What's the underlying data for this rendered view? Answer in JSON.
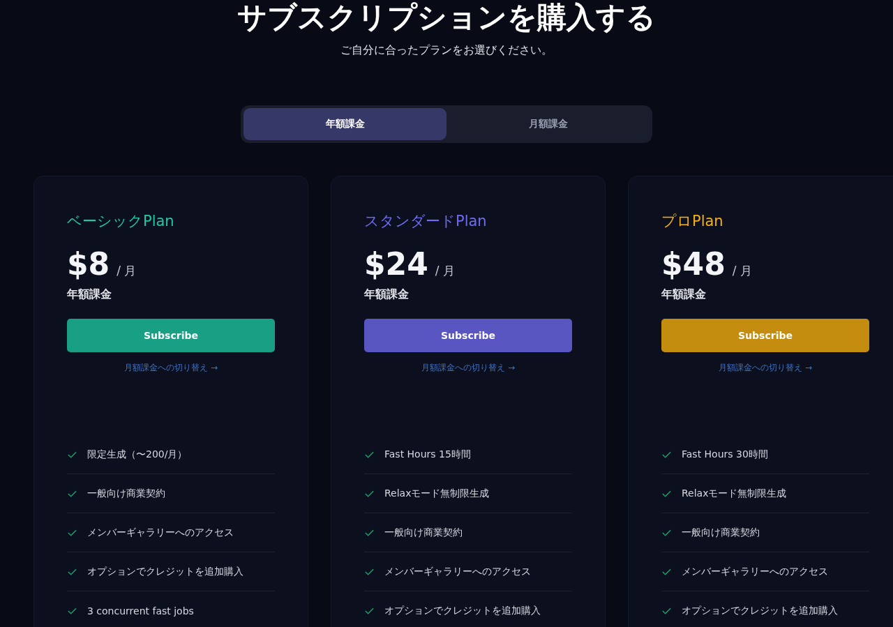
{
  "title": "サブスクリプションを購入する",
  "subtitle": "ご自分に合ったプランをお選びください。",
  "billing_tabs": [
    {
      "label": "年額課金",
      "selected": true
    },
    {
      "label": "月額課金",
      "selected": false
    }
  ],
  "plans": [
    {
      "name": "ベーシックPlan",
      "color": "#1fc8a5",
      "price": "$8",
      "per": "/ 月",
      "billing": "年額課金",
      "button": "Subscribe",
      "switch_link": "月額課金への切り替え →",
      "features": [
        "限定生成（〜200/月）",
        "一般向け商業契約",
        "メンバーギャラリーへのアクセス",
        "オプションでクレジットを追加購入",
        "3 concurrent fast jobs"
      ]
    },
    {
      "name": "スタンダードPlan",
      "color": "#6f6cf2",
      "price": "$24",
      "per": "/ 月",
      "billing": "年額課金",
      "button": "Subscribe",
      "switch_link": "月額課金への切り替え →",
      "features": [
        "Fast Hours 15時間",
        "Relaxモード無制限生成",
        "一般向け商業契約",
        "メンバーギャラリーへのアクセス",
        "オプションでクレジットを追加購入"
      ]
    },
    {
      "name": "プロPlan",
      "color": "#f5b014",
      "price": "$48",
      "per": "/ 月",
      "billing": "年額課金",
      "button": "Subscribe",
      "switch_link": "月額課金への切り替え →",
      "features": [
        "Fast Hours 30時間",
        "Relaxモード無制限生成",
        "一般向け商業契約",
        "メンバーギャラリーへのアクセス",
        "オプションでクレジットを追加購入"
      ]
    }
  ]
}
